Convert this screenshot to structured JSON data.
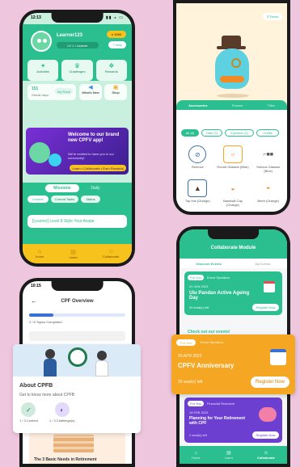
{
  "colors": {
    "background": "#eec7df",
    "green_primary": "#2bbf8f",
    "green_light": "#c9f0de",
    "orange": "#f5a623",
    "purple": "#6c3fd1",
    "yellow_nav": "#f7c21b"
  },
  "phone1": {
    "time": "12:13",
    "username": "Learner123",
    "points": "2000",
    "level_badge": "LV 1 • Learner",
    "help": "Help",
    "stat_chips": [
      {
        "label": "Activities",
        "icon": "puzzle-icon"
      },
      {
        "label": "Challenges",
        "icon": "trophy-icon"
      },
      {
        "label": "Rewards",
        "icon": "gift-icon"
      }
    ],
    "streak_count": "151",
    "streak_label": "Streak days",
    "my_rank": "My Rank",
    "whats_new": "What's New",
    "shop": "Shop",
    "welcome_title": "Welcome to our brand new CPFV app!",
    "welcome_sub": "We're excited to have you in our community!",
    "welcome_cta": "Learn • Collaborate • Earn Rewards",
    "tabs": [
      "Missions",
      "Daily"
    ],
    "filters": [
      "Learner",
      "Current Tasks",
      "Status"
    ],
    "mission_item": "[Learner] Level 8 Style Your Avatar",
    "nav": [
      "Home",
      "Learn",
      "Collaborate"
    ]
  },
  "phone2": {
    "reset": "Reset",
    "tabs": [
      "Accessories",
      "Frames",
      "Titles"
    ],
    "filters": [
      "All (6)",
      "Hats (3)",
      "Eyewear (3)",
      "Outfits"
    ],
    "items": [
      {
        "label": "Remove",
        "icon": "remove-icon"
      },
      {
        "label": "Round Glasses (Blue)",
        "icon": "glasses-icon"
      },
      {
        "label": "Serious Glasses (Blue)",
        "icon": "glasses-icon"
      },
      {
        "label": "Top Hat (Orange)",
        "icon": "top-hat-icon"
      },
      {
        "label": "Baseball Cap (Orange)",
        "icon": "cap-icon"
      },
      {
        "label": "Beret (Orange)",
        "icon": "beret-icon"
      }
    ]
  },
  "phone3": {
    "title": "CPF Overview",
    "progress_text": "2 / 8 Topics Completed",
    "progress_fraction": 0.25,
    "about_title": "About CPFB",
    "about_sub": "Get to know more about CPFB",
    "stats": [
      "1 / 3 Content",
      "1 / 3 Challenge(s)"
    ],
    "bottom_title": "The 3 Basic Needs in Retirement"
  },
  "phone4": {
    "title": "Collaborate Module",
    "tabs": [
      "Discover Events",
      "My Events"
    ],
    "event1": {
      "tag": "For You",
      "tag2": "Event Speakers",
      "date": "21 JUN 2023",
      "title": "Ulu Pandan Active Ageing Day",
      "left": "20 seat(s) left",
      "cta": "Register Now"
    },
    "check_out": "Check out our events!",
    "event2": {
      "tag": "For You",
      "tag2": "Event Speakers",
      "date": "20 APR 2023",
      "title": "CPFV Anniversary",
      "left": "20 seat(s) left",
      "cta": "Register Now"
    },
    "event3": {
      "tag": "For You",
      "tag2": "Financial Research",
      "date": "18 FEB 2023",
      "title": "Planning for Your Retirement with CPF",
      "left": "2 seat(s) left",
      "cta": "Register Now"
    },
    "nav": [
      "Home",
      "Learn",
      "Collaborate"
    ]
  }
}
